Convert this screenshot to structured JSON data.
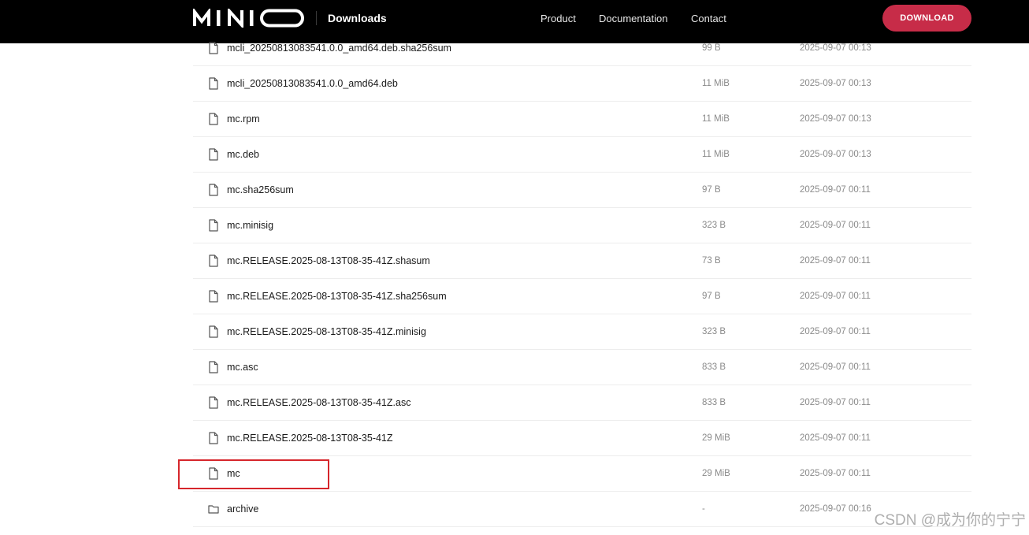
{
  "header": {
    "logo_text": "MINIO",
    "subtitle": "Downloads",
    "nav": [
      "Product",
      "Documentation",
      "Contact"
    ],
    "download_button": "DOWNLOAD"
  },
  "colors": {
    "header_bg": "#000000",
    "accent": "#c72c48",
    "highlight_border": "#d6262b"
  },
  "files": [
    {
      "name": "mcli_20250813083541.0.0_amd64.deb.sha256sum",
      "size": "99 B",
      "date": "2025-09-07 00:13",
      "icon": "file-icon"
    },
    {
      "name": "mcli_20250813083541.0.0_amd64.deb",
      "size": "11 MiB",
      "date": "2025-09-07 00:13",
      "icon": "file-icon"
    },
    {
      "name": "mc.rpm",
      "size": "11 MiB",
      "date": "2025-09-07 00:13",
      "icon": "file-icon"
    },
    {
      "name": "mc.deb",
      "size": "11 MiB",
      "date": "2025-09-07 00:13",
      "icon": "file-icon"
    },
    {
      "name": "mc.sha256sum",
      "size": "97 B",
      "date": "2025-09-07 00:11",
      "icon": "file-icon"
    },
    {
      "name": "mc.minisig",
      "size": "323 B",
      "date": "2025-09-07 00:11",
      "icon": "file-icon"
    },
    {
      "name": "mc.RELEASE.2025-08-13T08-35-41Z.shasum",
      "size": "73 B",
      "date": "2025-09-07 00:11",
      "icon": "file-icon"
    },
    {
      "name": "mc.RELEASE.2025-08-13T08-35-41Z.sha256sum",
      "size": "97 B",
      "date": "2025-09-07 00:11",
      "icon": "file-icon"
    },
    {
      "name": "mc.RELEASE.2025-08-13T08-35-41Z.minisig",
      "size": "323 B",
      "date": "2025-09-07 00:11",
      "icon": "file-icon"
    },
    {
      "name": "mc.asc",
      "size": "833 B",
      "date": "2025-09-07 00:11",
      "icon": "file-icon"
    },
    {
      "name": "mc.RELEASE.2025-08-13T08-35-41Z.asc",
      "size": "833 B",
      "date": "2025-09-07 00:11",
      "icon": "file-icon"
    },
    {
      "name": "mc.RELEASE.2025-08-13T08-35-41Z",
      "size": "29 MiB",
      "date": "2025-09-07 00:11",
      "icon": "file-icon"
    },
    {
      "name": "mc",
      "size": "29 MiB",
      "date": "2025-09-07 00:11",
      "icon": "file-icon"
    },
    {
      "name": "archive",
      "size": "-",
      "date": "2025-09-07 00:16",
      "icon": "folder-icon"
    }
  ],
  "watermark": "CSDN @成为你的宁宁"
}
